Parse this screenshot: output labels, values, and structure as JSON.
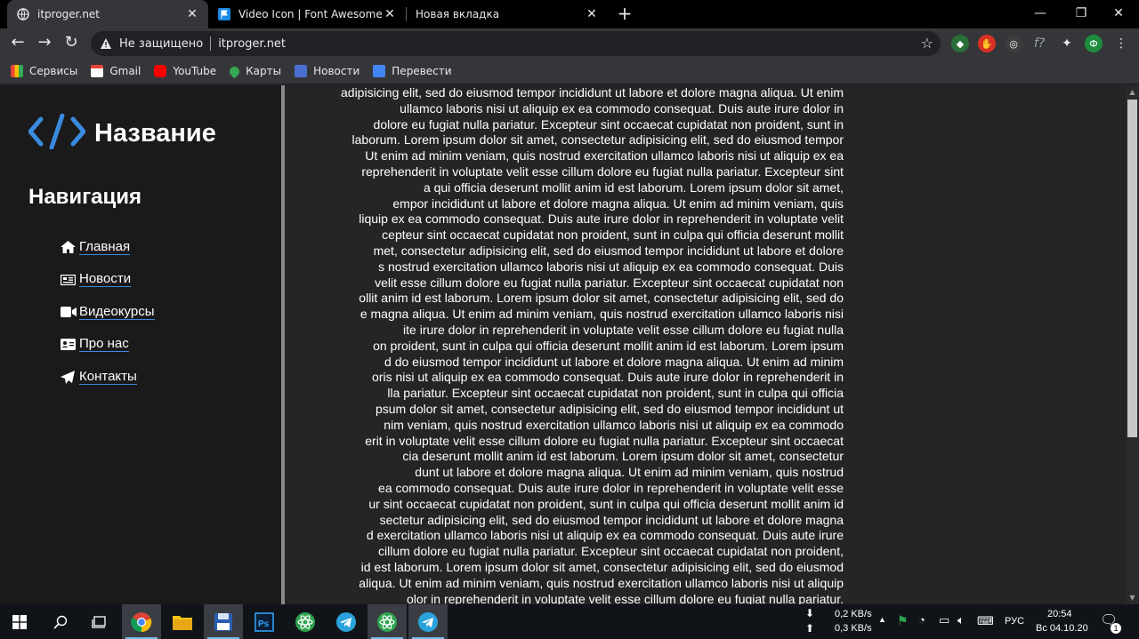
{
  "browser": {
    "tabs": [
      {
        "title": "itproger.net",
        "active": true
      },
      {
        "title": "Video Icon | Font Awesome",
        "active": false
      },
      {
        "title": "Новая вкладка",
        "active": false
      }
    ],
    "security_label": "Не защищено",
    "url": "itproger.net",
    "bookmarks": [
      "Сервисы",
      "Gmail",
      "YouTube",
      "Карты",
      "Новости",
      "Перевести"
    ],
    "profile_initial": "Ф"
  },
  "page": {
    "logo_text": "Название",
    "nav_title": "Навигация",
    "nav_items": [
      {
        "label": "Главная",
        "icon": "home-icon"
      },
      {
        "label": "Новости",
        "icon": "newspaper-icon"
      },
      {
        "label": "Видеокурсы",
        "icon": "video-icon"
      },
      {
        "label": "Про нас",
        "icon": "id-card-icon"
      },
      {
        "label": "Контакты",
        "icon": "paper-plane-icon"
      }
    ],
    "content_lines": [
      "adipisicing elit, sed do eiusmod tempor incididunt ut labore et dolore magna aliqua. Ut enim",
      "ullamco laboris nisi ut aliquip ex ea commodo consequat. Duis aute irure dolor in",
      "dolore eu fugiat nulla pariatur. Excepteur sint occaecat cupidatat non proident, sunt in",
      "laborum. Lorem ipsum dolor sit amet, consectetur adipisicing elit, sed do eiusmod tempor",
      "Ut enim ad minim veniam, quis nostrud exercitation ullamco laboris nisi ut aliquip ex ea",
      "reprehenderit in voluptate velit esse cillum dolore eu fugiat nulla pariatur. Excepteur sint",
      "a qui officia deserunt mollit anim id est laborum. Lorem ipsum dolor sit amet,",
      "empor incididunt ut labore et dolore magna aliqua. Ut enim ad minim veniam, quis",
      "liquip ex ea commodo consequat. Duis aute irure dolor in reprehenderit in voluptate velit",
      "cepteur sint occaecat cupidatat non proident, sunt in culpa qui officia deserunt mollit",
      "met, consectetur adipisicing elit, sed do eiusmod tempor incididunt ut labore et dolore",
      "s nostrud exercitation ullamco laboris nisi ut aliquip ex ea commodo consequat. Duis",
      "velit esse cillum dolore eu fugiat nulla pariatur. Excepteur sint occaecat cupidatat non",
      "ollit anim id est laborum. Lorem ipsum dolor sit amet, consectetur adipisicing elit, sed do",
      "e magna aliqua. Ut enim ad minim veniam, quis nostrud exercitation ullamco laboris nisi",
      "ite irure dolor in reprehenderit in voluptate velit esse cillum dolore eu fugiat nulla",
      "on proident, sunt in culpa qui officia deserunt mollit anim id est laborum. Lorem ipsum",
      "d do eiusmod tempor incididunt ut labore et dolore magna aliqua. Ut enim ad minim",
      "oris nisi ut aliquip ex ea commodo consequat. Duis aute irure dolor in reprehenderit in",
      "lla pariatur. Excepteur sint occaecat cupidatat non proident, sunt in culpa qui officia",
      "psum dolor sit amet, consectetur adipisicing elit, sed do eiusmod tempor incididunt ut",
      "nim veniam, quis nostrud exercitation ullamco laboris nisi ut aliquip ex ea commodo",
      "erit in voluptate velit esse cillum dolore eu fugiat nulla pariatur. Excepteur sint occaecat",
      "cia deserunt mollit anim id est laborum. Lorem ipsum dolor sit amet, consectetur",
      "dunt ut labore et dolore magna aliqua. Ut enim ad minim veniam, quis nostrud",
      "ea commodo consequat. Duis aute irure dolor in reprehenderit in voluptate velit esse",
      "ur sint occaecat cupidatat non proident, sunt in culpa qui officia deserunt mollit anim id",
      "sectetur adipisicing elit, sed do eiusmod tempor incididunt ut labore et dolore magna",
      "d exercitation ullamco laboris nisi ut aliquip ex ea commodo consequat. Duis aute irure",
      "cillum dolore eu fugiat nulla pariatur. Excepteur sint occaecat cupidatat non proident,",
      "id est laborum. Lorem ipsum dolor sit amet, consectetur adipisicing elit, sed do eiusmod",
      "aliqua. Ut enim ad minim veniam, quis nostrud exercitation ullamco laboris nisi ut aliquip",
      "olor in reprehenderit in voluptate velit esse cillum dolore eu fugiat nulla pariatur."
    ]
  },
  "taskbar": {
    "net_down": "0,2 KB/s",
    "net_up": "0,3 KB/s",
    "language": "РУС",
    "time": "20:54",
    "date": "Вс 04.10.20",
    "notification_count": "1"
  },
  "colors": {
    "accent_blue": "#3a8be0",
    "sidebar_bg": "#1a1a1a",
    "content_bg": "#252525"
  }
}
